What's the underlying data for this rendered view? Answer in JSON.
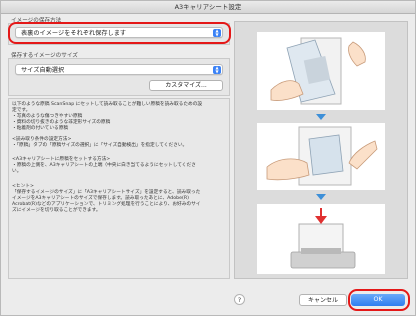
{
  "window": {
    "title": "A3キャリアシート設定"
  },
  "save_method": {
    "label": "イメージの保存方法",
    "selected": "表裏のイメージをそれぞれ保存します",
    "highlight_color": "#e41818"
  },
  "size": {
    "label": "保存するイメージのサイズ",
    "selected": "サイズ自動選択",
    "customize_button": "カスタマイズ..."
  },
  "description": {
    "intro": "以下のような原稿 ScanSnap にセットして読み取ることが難しい原稿を読み取るための設\n定です。\n・写真のような傷つきやすい原稿\n・資料の切り抜きのような非定形サイズの原稿\n・粘着剤の付いている原稿",
    "howto": "<読み取り条件の設定方法>\n・「原稿」タブの「原稿サイズの選択」に「サイズ自動検出」を指定してください。",
    "carrier": "<A3キャリアシートに原稿をセットする方法>\n・原稿の上側を、A3キャリアシートの上端（中央に白き当てるようにセットしてくださ\nい。",
    "hint": "<ヒント>\n「保存するイメージのサイズ」に「A3キャリアシートサイズ」を設定すると、読み取った\nイメージをA3キャリアシートのサイズで保存します。読み取ったあとに、Adobe(R)\nAcrobat(R)などのアプリケーションで、トリミング処理を行うことにより、お好みのサイ\nズにイメージを切り取ることができます。"
  },
  "footer": {
    "help": "?",
    "cancel": "キャンセル",
    "ok": "OK"
  },
  "colors": {
    "accent": "#2f7ef0",
    "step_arrow": "#3d8fd8"
  }
}
